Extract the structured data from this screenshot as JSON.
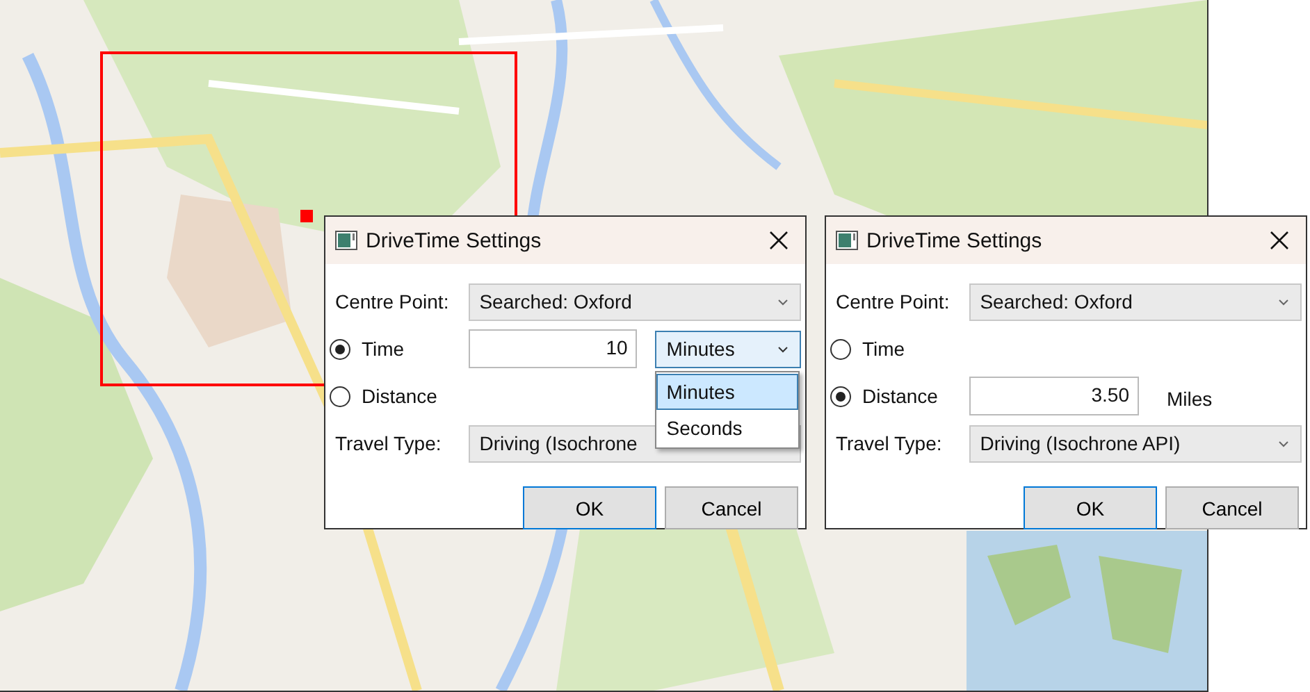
{
  "dialogs": [
    {
      "title": "DriveTime Settings",
      "centre_point": {
        "label": "Centre Point:",
        "value": "Searched: Oxford"
      },
      "options": [
        {
          "label": "Time",
          "selected": true,
          "value": "10",
          "unit": {
            "kind": "combo",
            "value": "Minutes",
            "open": true,
            "items": [
              {
                "label": "Minutes",
                "selected": true
              },
              {
                "label": "Seconds",
                "selected": false
              }
            ]
          }
        },
        {
          "label": "Distance",
          "selected": false
        }
      ],
      "travel_type": {
        "label": "Travel Type:",
        "value": "Driving (Isochrone"
      },
      "buttons": [
        {
          "label": "OK",
          "default": true
        },
        {
          "label": "Cancel",
          "default": false
        }
      ]
    },
    {
      "title": "DriveTime Settings",
      "centre_point": {
        "label": "Centre Point:",
        "value": "Searched: Oxford"
      },
      "options": [
        {
          "label": "Time",
          "selected": false
        },
        {
          "label": "Distance",
          "selected": true,
          "value": "3.50",
          "unit": {
            "kind": "text",
            "value": "Miles"
          }
        }
      ],
      "travel_type": {
        "label": "Travel Type:",
        "value": "Driving (Isochrone API)"
      },
      "buttons": [
        {
          "label": "OK",
          "default": true
        },
        {
          "label": "Cancel",
          "default": false
        }
      ]
    }
  ]
}
